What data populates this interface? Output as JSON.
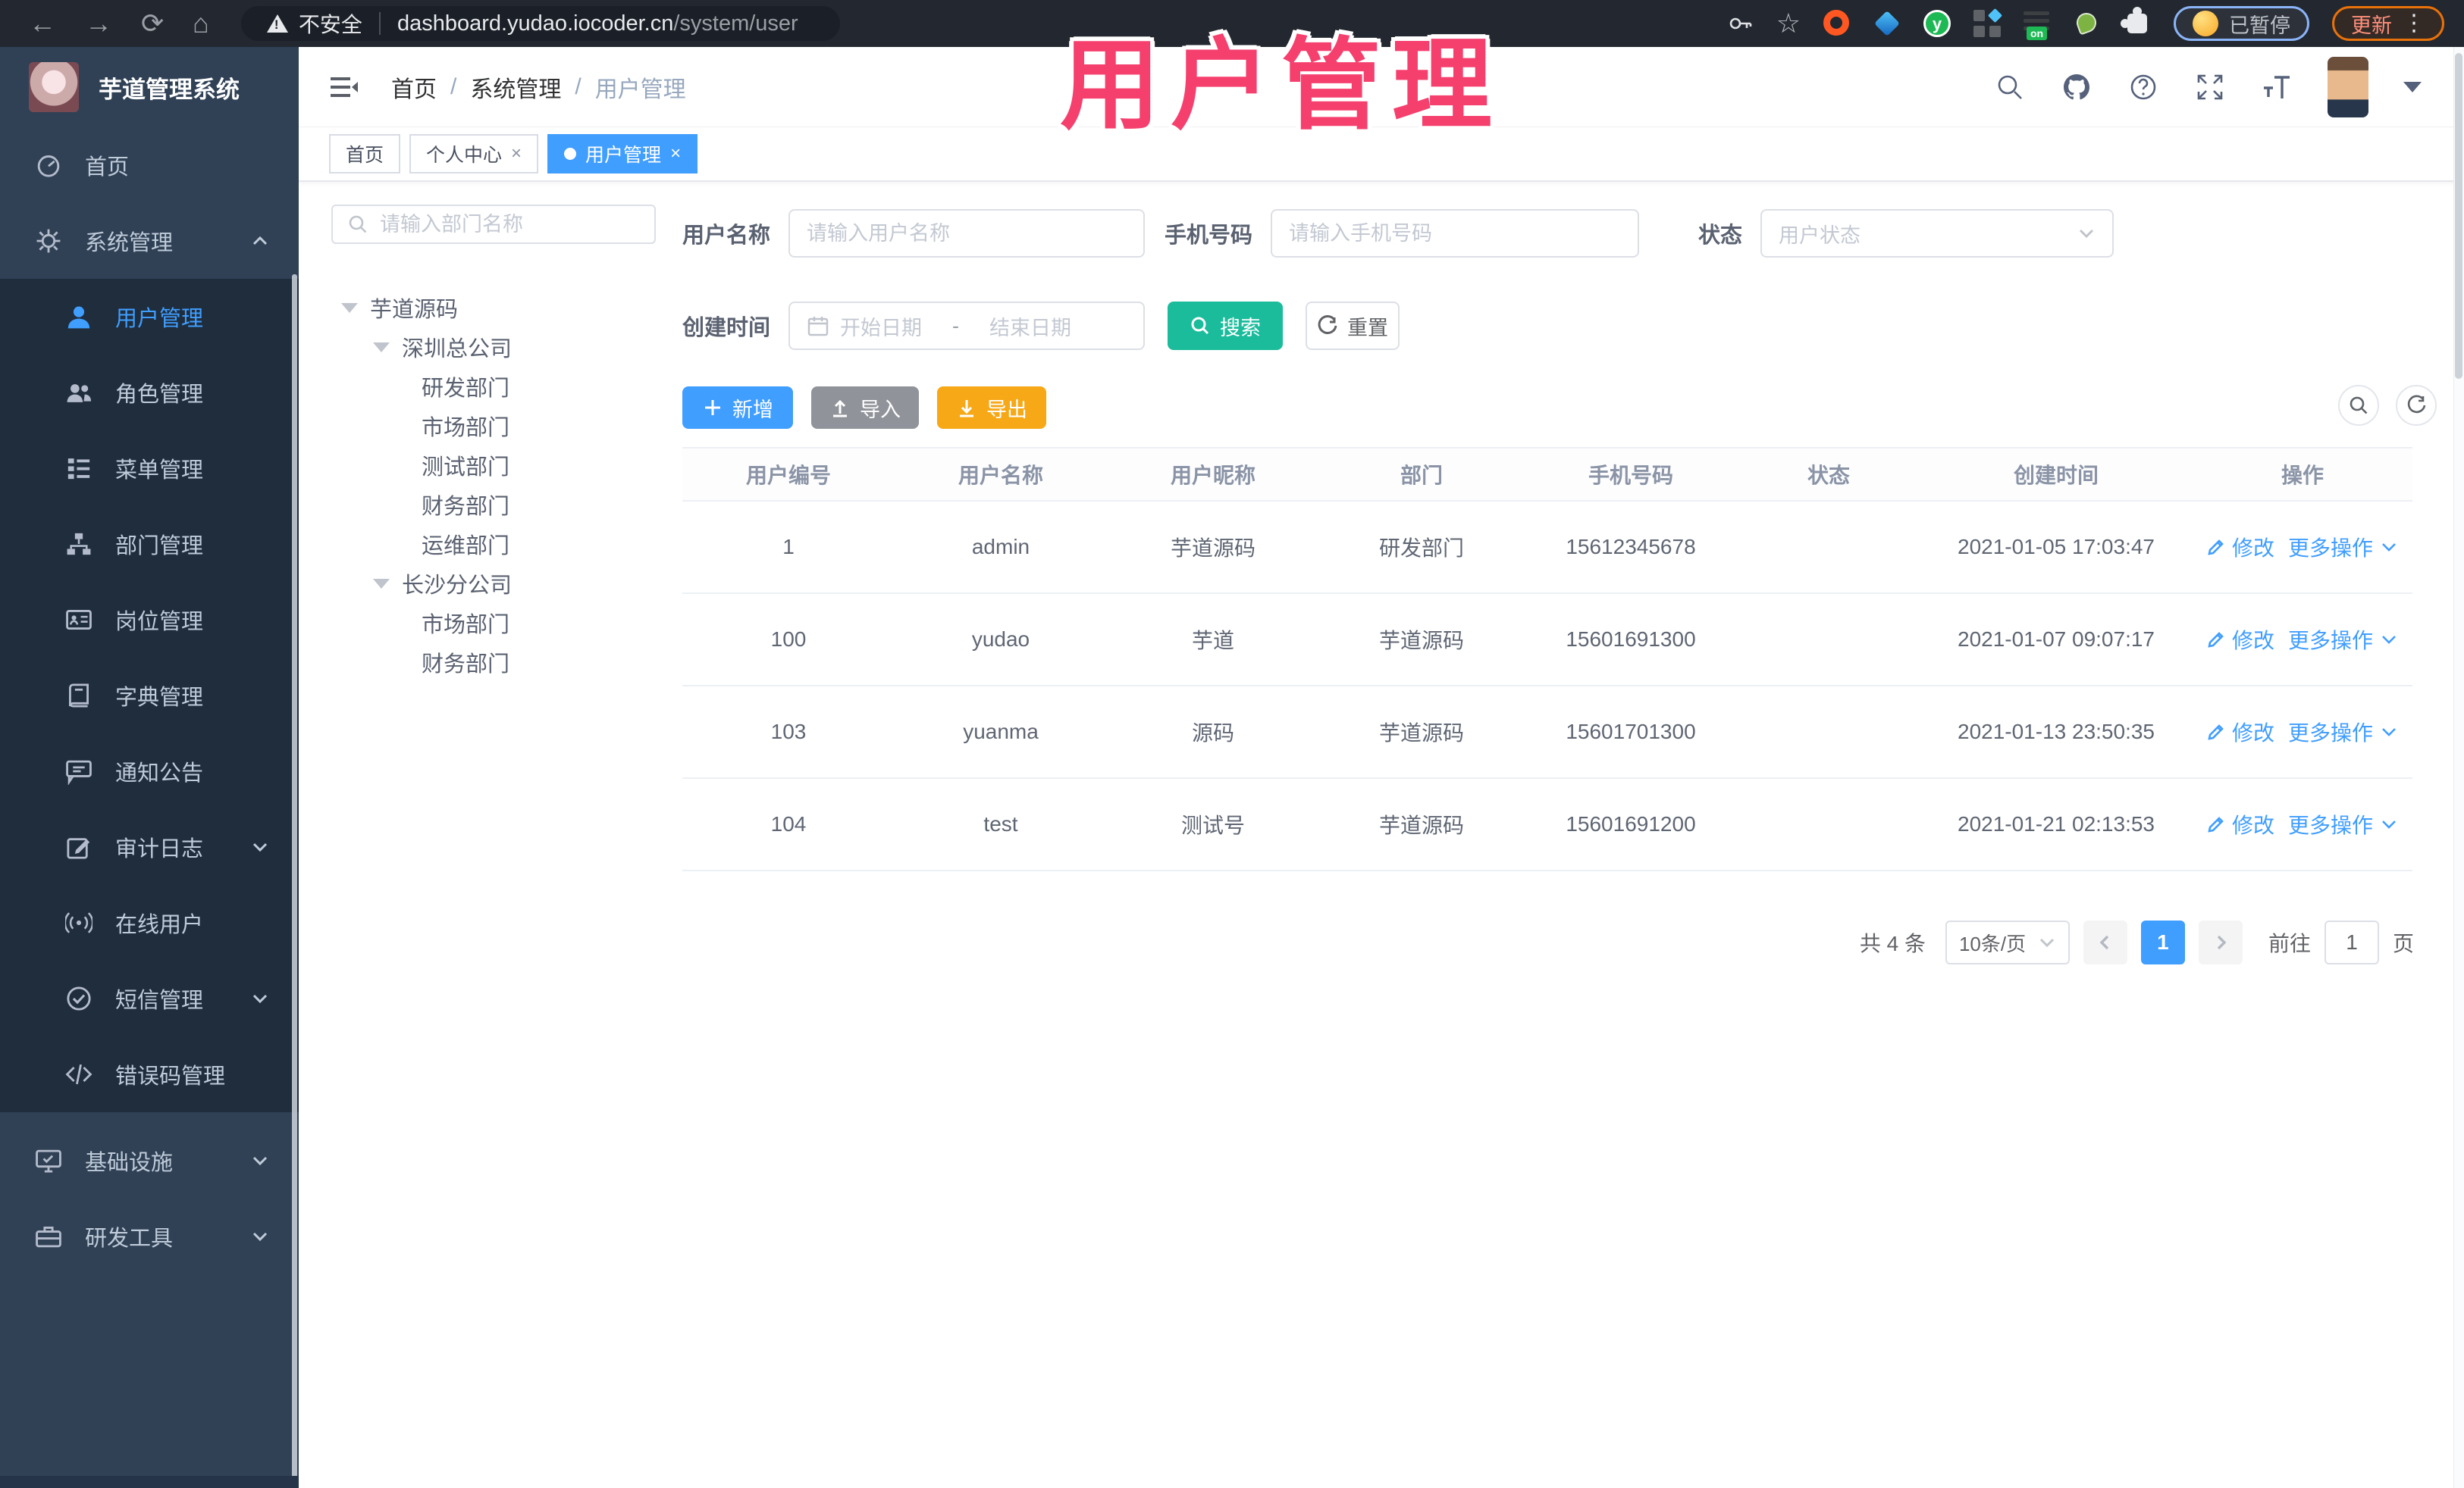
{
  "browser": {
    "secure_label": "不安全",
    "url_host": "dashboard.yudao.iocoder.cn",
    "url_path": "/system/user",
    "paused_badge": "已暂停",
    "update_button": "更新",
    "nav_icons": [
      "back-arrow",
      "forward-arrow",
      "reload",
      "home"
    ],
    "extension_icons": [
      "key",
      "star",
      "orange-ring",
      "blue-drop",
      "green-y",
      "grid",
      "list-on",
      "green-tadpole",
      "puzzle"
    ]
  },
  "overlay_title": "用户管理",
  "app_header": {
    "logo_title": "芋道管理系统",
    "breadcrumb": [
      "首页",
      "系统管理",
      "用户管理"
    ],
    "icons": [
      "search",
      "github",
      "help",
      "fullscreen",
      "font-size",
      "avatar",
      "caret-down"
    ]
  },
  "tabs": [
    {
      "label": "首页"
    },
    {
      "label": "个人中心"
    },
    {
      "label": "用户管理"
    }
  ],
  "sidebar": {
    "items": [
      {
        "label": "首页",
        "icon": "dashboard"
      },
      {
        "label": "系统管理",
        "icon": "gear"
      },
      {
        "label": "用户管理",
        "icon": "user"
      },
      {
        "label": "角色管理",
        "icon": "users"
      },
      {
        "label": "菜单管理",
        "icon": "menu-list"
      },
      {
        "label": "部门管理",
        "icon": "org-tree"
      },
      {
        "label": "岗位管理",
        "icon": "id-card"
      },
      {
        "label": "字典管理",
        "icon": "book"
      },
      {
        "label": "通知公告",
        "icon": "megaphone"
      },
      {
        "label": "审计日志",
        "icon": "edit-log"
      },
      {
        "label": "在线用户",
        "icon": "broadcast"
      },
      {
        "label": "短信管理",
        "icon": "check-circle"
      },
      {
        "label": "错误码管理",
        "icon": "code"
      },
      {
        "label": "基础设施",
        "icon": "monitor"
      },
      {
        "label": "研发工具",
        "icon": "toolbox"
      }
    ]
  },
  "tree": {
    "search_placeholder": "请输入部门名称",
    "nodes": [
      {
        "label": "芋道源码"
      },
      {
        "label": "深圳总公司"
      },
      {
        "label": "研发部门"
      },
      {
        "label": "市场部门"
      },
      {
        "label": "测试部门"
      },
      {
        "label": "财务部门"
      },
      {
        "label": "运维部门"
      },
      {
        "label": "长沙分公司"
      },
      {
        "label": "市场部门"
      },
      {
        "label": "财务部门"
      }
    ]
  },
  "filters": {
    "username_label": "用户名称",
    "username_placeholder": "请输入用户名称",
    "mobile_label": "手机号码",
    "mobile_placeholder": "请输入手机号码",
    "status_label": "状态",
    "status_placeholder": "用户状态",
    "time_label": "创建时间",
    "start_placeholder": "开始日期",
    "range_separator": "-",
    "end_placeholder": "结束日期",
    "search": "搜索",
    "reset": "重置"
  },
  "toolbar": {
    "add": "新增",
    "import": "导入",
    "export": "导出"
  },
  "table": {
    "columns": [
      "用户编号",
      "用户名称",
      "用户昵称",
      "部门",
      "手机号码",
      "状态",
      "创建时间",
      "操作"
    ],
    "actions": {
      "edit": "修改",
      "more": "更多操作"
    },
    "rows": [
      {
        "id": "1",
        "username": "admin",
        "nickname": "芋道源码",
        "dept": "研发部门",
        "mobile": "15612345678",
        "status_on": true,
        "created": "2021-01-05 17:03:47"
      },
      {
        "id": "100",
        "username": "yudao",
        "nickname": "芋道",
        "dept": "芋道源码",
        "mobile": "15601691300",
        "status_on": false,
        "created": "2021-01-07 09:07:17"
      },
      {
        "id": "103",
        "username": "yuanma",
        "nickname": "源码",
        "dept": "芋道源码",
        "mobile": "15601701300",
        "status_on": true,
        "created": "2021-01-13 23:50:35"
      },
      {
        "id": "104",
        "username": "test",
        "nickname": "测试号",
        "dept": "芋道源码",
        "mobile": "15601691200",
        "status_on": true,
        "created": "2021-01-21 02:13:53"
      }
    ]
  },
  "pagination": {
    "total": "共 4 条",
    "page_size": "10条/页",
    "current_page": "1",
    "goto_label": "前往",
    "goto_value": "1",
    "unit_label": "页"
  },
  "colors": {
    "primary": "#409eff",
    "sidebar_bg": "#304156",
    "submenu_bg": "#1f2d3d",
    "search_button": "#1abc9c",
    "export_button": "#f6a817",
    "import_button": "#909399",
    "overlay_pink": "#f5406e",
    "toggle_on": "#409eff"
  }
}
